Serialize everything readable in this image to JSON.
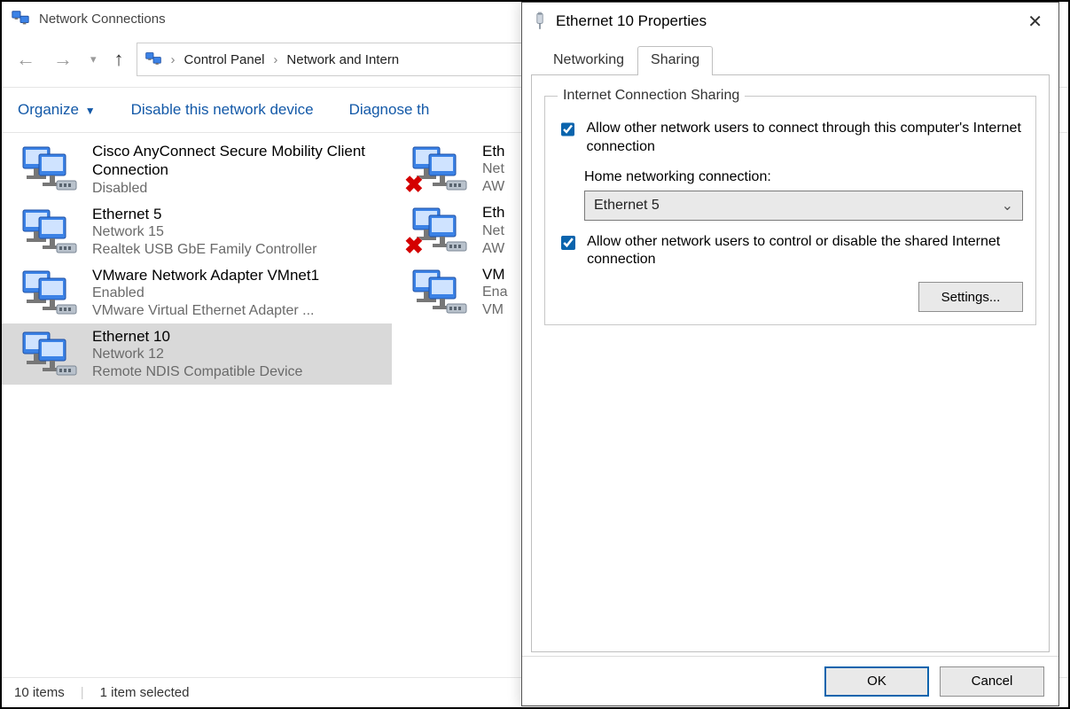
{
  "explorer": {
    "title": "Network Connections",
    "breadcrumbs": [
      "Control Panel",
      "Network and Intern"
    ],
    "toolbar": {
      "organize": "Organize",
      "disable": "Disable this network device",
      "diagnose": "Diagnose th"
    },
    "connections_col1": [
      {
        "name": "Cisco AnyConnect Secure Mobility Client Connection",
        "line2": "Disabled",
        "line3": "",
        "error": false,
        "selected": false
      },
      {
        "name": "Ethernet 5",
        "line2": "Network 15",
        "line3": "Realtek USB GbE Family Controller",
        "error": false,
        "selected": false
      },
      {
        "name": "VMware Network Adapter VMnet1",
        "line2": "Enabled",
        "line3": "VMware Virtual Ethernet Adapter ...",
        "error": false,
        "selected": false
      },
      {
        "name": "Ethernet 10",
        "line2": "Network 12",
        "line3": "Remote NDIS Compatible Device",
        "error": false,
        "selected": true
      }
    ],
    "connections_col2": [
      {
        "name": "Eth",
        "line2": "Net",
        "line3": "AW",
        "error": true
      },
      {
        "name": "Eth",
        "line2": "Net",
        "line3": "AW",
        "error": true
      },
      {
        "name": "VM",
        "line2": "Ena",
        "line3": "VM",
        "error": false
      }
    ],
    "status": {
      "items": "10 items",
      "selected": "1 item selected"
    }
  },
  "dialog": {
    "title": "Ethernet 10 Properties",
    "tabs": {
      "networking": "Networking",
      "sharing": "Sharing"
    },
    "group_legend": "Internet Connection Sharing",
    "chk_allow_connect": "Allow other network users to connect through this computer's Internet connection",
    "home_label": "Home networking connection:",
    "home_value": "Ethernet 5",
    "chk_allow_control": "Allow other network users to control or disable the shared Internet connection",
    "settings_btn": "Settings...",
    "ok": "OK",
    "cancel": "Cancel"
  }
}
